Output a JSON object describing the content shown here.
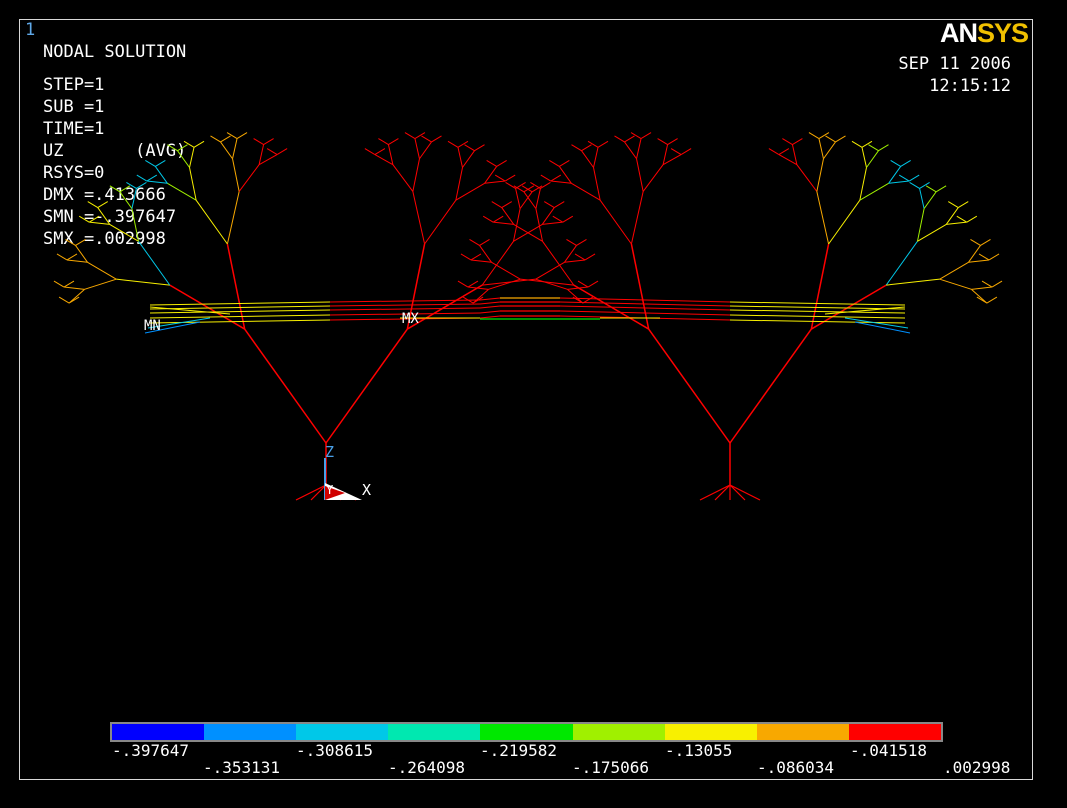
{
  "window_number": "1",
  "logo": {
    "part1": "AN",
    "part2": "SYS"
  },
  "title": "NODAL SOLUTION",
  "info_lines": [
    "STEP=1",
    "SUB =1",
    "TIME=1",
    "UZ       (AVG)",
    "RSYS=0",
    "DMX =.413666",
    "SMN =-.397647",
    "SMX =.002998"
  ],
  "date": "SEP 11 2006",
  "time": "12:15:12",
  "markers": {
    "min": "MN",
    "max": "MX"
  },
  "axes": {
    "z": "Z",
    "x": "X",
    "y": "Y"
  },
  "legend": {
    "colors": [
      "#0000ff",
      "#0090ff",
      "#00c8e8",
      "#00e8b0",
      "#00e800",
      "#a0f000",
      "#f8f000",
      "#f8a800",
      "#ff0000"
    ],
    "labels_top": [
      "-.397647",
      "-.308615",
      "-.219582",
      "-.13055",
      "-.041518"
    ],
    "labels_bottom": [
      "-.353131",
      "-.264098",
      "-.175066",
      "-.086034",
      ".002998"
    ]
  }
}
